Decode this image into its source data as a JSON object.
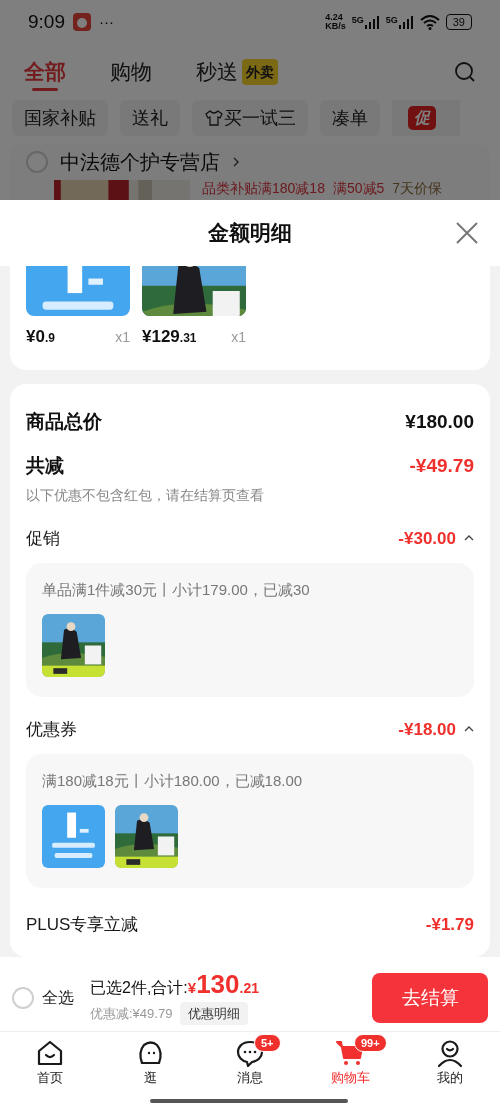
{
  "status_bar": {
    "time": "9:09",
    "more": "···",
    "speed": "4.24",
    "speed_unit": "KB/s",
    "networks": [
      "5G",
      "5G"
    ],
    "battery": "39"
  },
  "top_tabs": [
    {
      "label": "全部",
      "selected": true
    },
    {
      "label": "购物",
      "selected": false
    },
    {
      "label": "秒送",
      "badge": "外卖",
      "selected": false
    }
  ],
  "chips": [
    {
      "kind": "text",
      "label": "国家补贴"
    },
    {
      "kind": "text",
      "label": "送礼"
    },
    {
      "kind": "icon",
      "label": "买一试三"
    },
    {
      "kind": "text",
      "label": "凑单"
    },
    {
      "kind": "promo",
      "label": "促"
    }
  ],
  "store": {
    "name": "中法德个护专营店",
    "checked": false,
    "promos": [
      {
        "label": "品类补贴满180减18",
        "kind": "discount"
      },
      {
        "label": "满50减5",
        "kind": "discount"
      },
      {
        "label": "7天价保",
        "kind": "guarantee"
      }
    ]
  },
  "sheet": {
    "title": "金额明细",
    "items": [
      {
        "kind": "coupon",
        "price": "¥0",
        "price_decimal": ".9",
        "qty": "x1"
      },
      {
        "kind": "product",
        "price": "¥129",
        "price_decimal": ".31",
        "qty": "x1"
      }
    ],
    "summary": {
      "total_label": "商品总价",
      "total": "¥180.00",
      "discount_label": "共减",
      "discount": "-¥49.79",
      "note": "以下优惠不包含红包，请在结算页查看"
    },
    "groups": [
      {
        "label": "促销",
        "amount": "-¥30.00",
        "expanded": true,
        "detail": "单品满1件减30元丨小计179.00，已减30",
        "items": [
          {
            "kind": "product"
          }
        ]
      },
      {
        "label": "优惠券",
        "amount": "-¥18.00",
        "expanded": true,
        "detail": "满180减18元丨小计180.00，已减18.00",
        "items": [
          {
            "kind": "coupon"
          },
          {
            "kind": "product"
          }
        ]
      }
    ],
    "plus": {
      "label": "PLUS专享立减",
      "amount": "-¥1.79"
    }
  },
  "checkout": {
    "select_all": "全选",
    "checked": false,
    "summary": "已选2件,合计:",
    "currency": "¥",
    "total": "130",
    "total_decimal": ".21",
    "discount": "优惠减:¥49.79",
    "detail_button": "优惠明细",
    "checkout_button": "去结算"
  },
  "nav": [
    {
      "kind": "home",
      "label": "首页",
      "selected": false
    },
    {
      "kind": "browse",
      "label": "逛",
      "selected": false
    },
    {
      "kind": "messages",
      "label": "消息",
      "badge": "5+",
      "selected": false
    },
    {
      "kind": "cart",
      "label": "购物车",
      "badge": "99+",
      "selected": true
    },
    {
      "kind": "profile",
      "label": "我的",
      "selected": false
    }
  ]
}
